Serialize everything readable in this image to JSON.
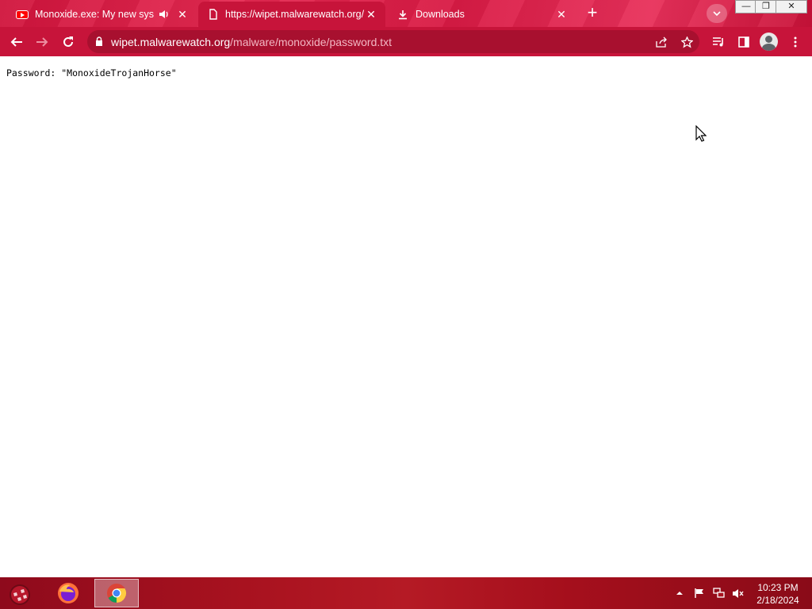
{
  "browser": {
    "tabs": [
      {
        "title": "Monoxide.exe: My new syste",
        "favicon": "youtube-icon",
        "audio": true,
        "active": false
      },
      {
        "title": "https://wipet.malwarewatch.org/",
        "favicon": "file-icon",
        "active": true
      },
      {
        "title": "Downloads",
        "favicon": "download-icon",
        "active": false
      }
    ],
    "address": {
      "host": "wipet.malwarewatch.org",
      "path": "/malware/monoxide/password.txt"
    }
  },
  "page": {
    "text": "Password: \"MonoxideTrojanHorse\""
  },
  "taskbar": {
    "time": "10:23 PM",
    "date": "2/18/2024"
  },
  "colors": {
    "accent": "#c7143a",
    "taskbar": "#a8121f"
  }
}
